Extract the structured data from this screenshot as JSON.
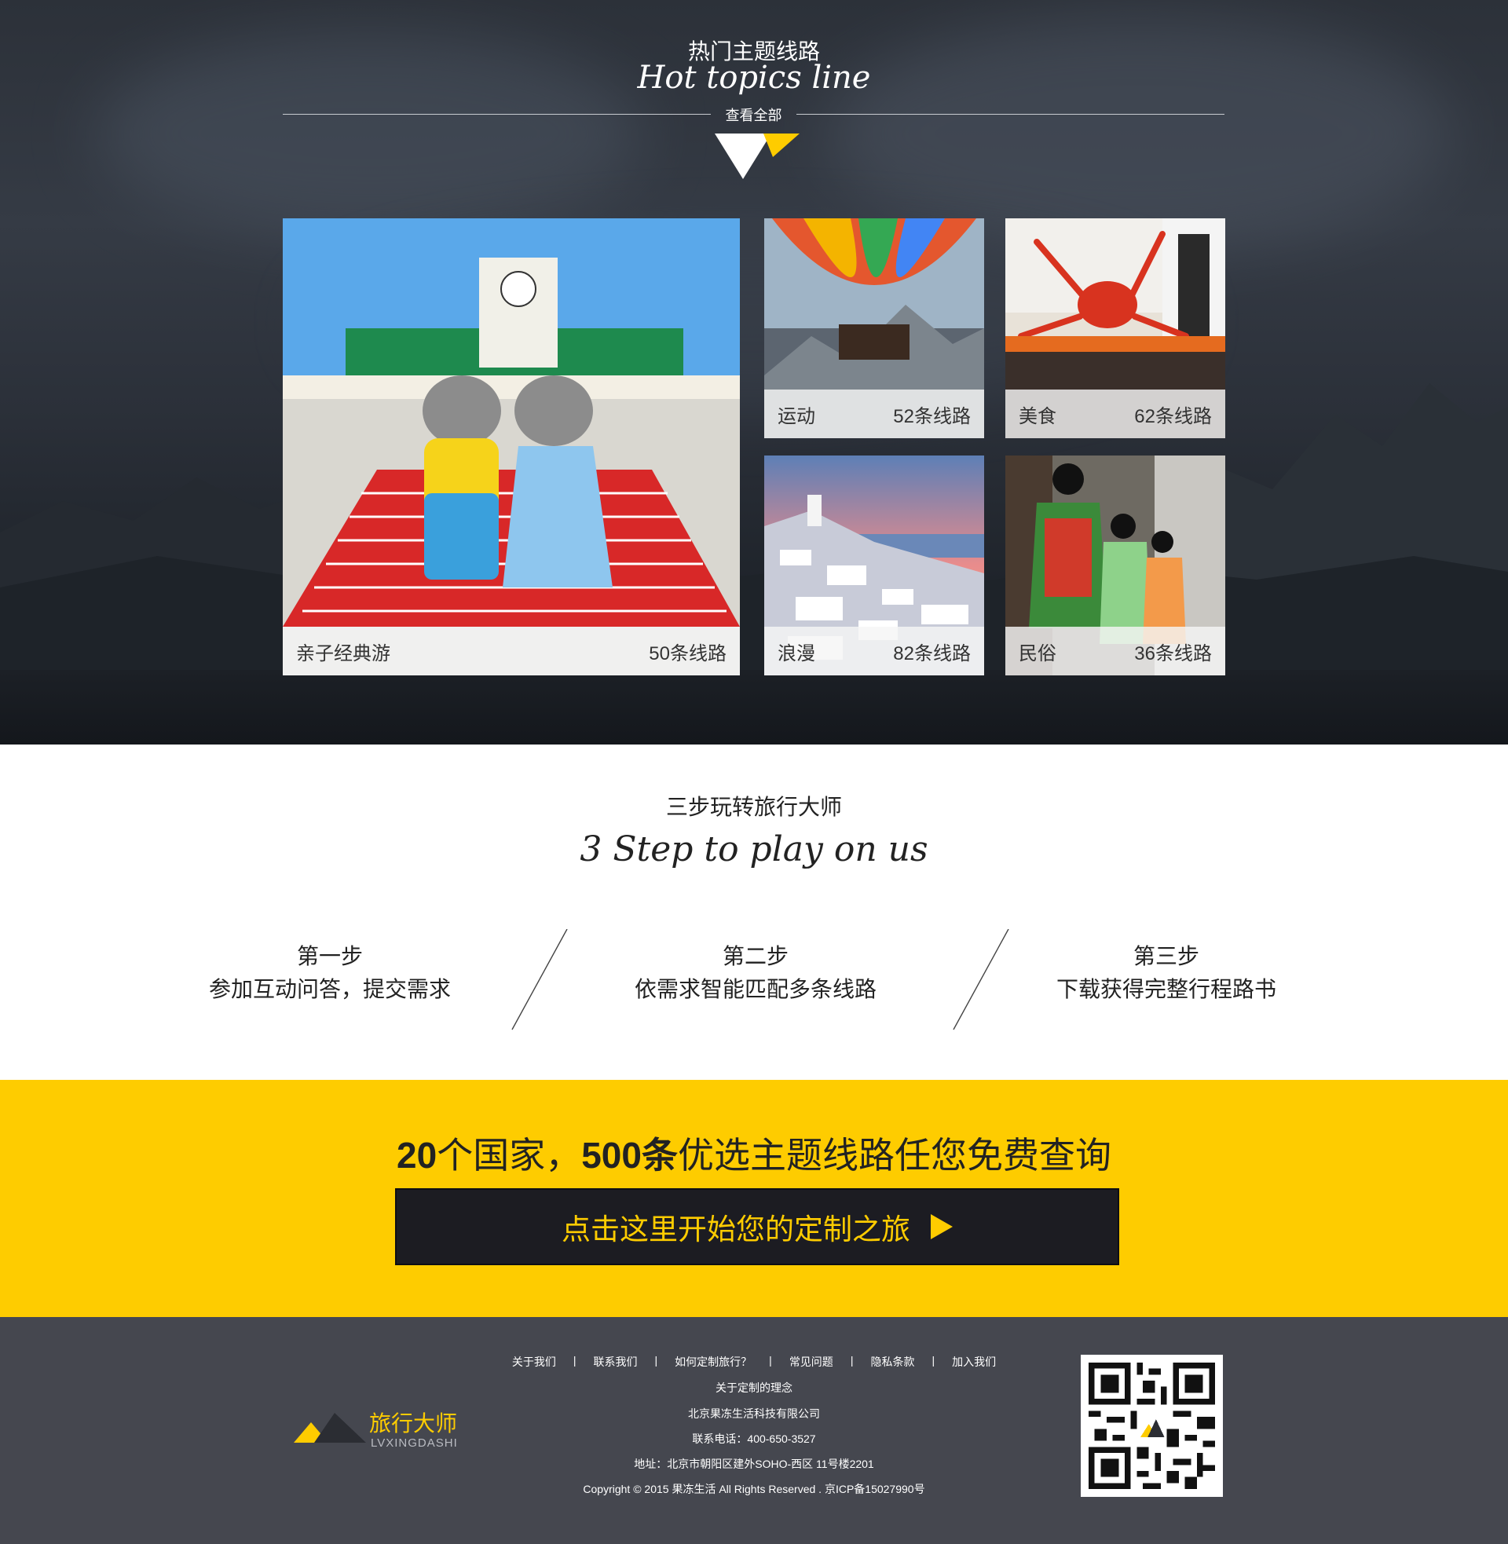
{
  "colors": {
    "accent": "#fecc00",
    "footer_bg": "#45474f",
    "cta_bg": "#fecc00",
    "dark_button": "#1c1c22"
  },
  "hero": {
    "title_cn": "热门主题线路",
    "title_en": "Hot topics line",
    "view_all": "查看全部"
  },
  "themes": [
    {
      "name": "亲子经典游",
      "count": "50条线路"
    },
    {
      "name": "运动",
      "count": "52条线路"
    },
    {
      "name": "美食",
      "count": "62条线路"
    },
    {
      "name": "浪漫",
      "count": "82条线路"
    },
    {
      "name": "民俗",
      "count": "36条线路"
    }
  ],
  "steps": {
    "title_cn": "三步玩转旅行大师",
    "title_en": "3 Step to play on us",
    "items": [
      {
        "title": "第一步",
        "desc": "参加互动问答，提交需求"
      },
      {
        "title": "第二步",
        "desc": "依需求智能匹配多条线路"
      },
      {
        "title": "第三步",
        "desc": "下载获得完整行程路书"
      }
    ]
  },
  "cta": {
    "num1": "20",
    "text1": "个国家，",
    "num2": "500",
    "text2": "条",
    "text3": "优选主题线路任您免费查询",
    "button": "点击这里开始您的定制之旅",
    "button_icon": "play-icon"
  },
  "footer": {
    "nav": [
      "关于我们",
      "联系我们",
      "如何定制旅行？",
      "常见问题",
      "隐私条款",
      "加入我们"
    ],
    "separator": "|",
    "concept": "关于定制的理念",
    "company": "北京果冻生活科技有限公司",
    "phone": "联系电话：400-650-3527",
    "address": "地址：北京市朝阳区建外SOHO-西区 11号楼2201",
    "copyright": "Copyright © 2015 果冻生活 All Rights Reserved . 京ICP备15027990号",
    "logo_name": "旅行大师",
    "logo_pinyin": "LVXINGDASHI"
  }
}
